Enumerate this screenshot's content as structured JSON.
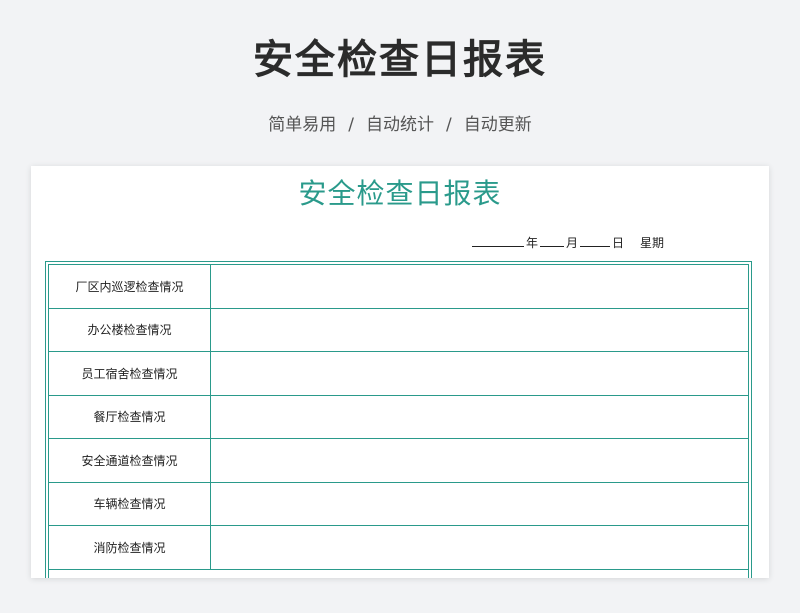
{
  "header": {
    "title": "安全检查日报表",
    "subtitle_items": [
      "简单易用",
      "自动统计",
      "自动更新"
    ],
    "separator": "/"
  },
  "sheet": {
    "title": "安全检查日报表",
    "date_line": {
      "year_label": "年",
      "month_label": "月",
      "day_label": "日",
      "week_label": "星期"
    },
    "rows": [
      {
        "label": "厂区内巡逻检查情况",
        "value": ""
      },
      {
        "label": "办公楼检查情况",
        "value": ""
      },
      {
        "label": "员工宿舍检查情况",
        "value": ""
      },
      {
        "label": "餐厅检查情况",
        "value": ""
      },
      {
        "label": "安全通道检查情况",
        "value": ""
      },
      {
        "label": "车辆检查情况",
        "value": ""
      },
      {
        "label": "消防检查情况",
        "value": ""
      }
    ]
  },
  "colors": {
    "accent": "#2a9a8b",
    "background": "#f2f3f5",
    "title_text": "#2b2b2b"
  }
}
